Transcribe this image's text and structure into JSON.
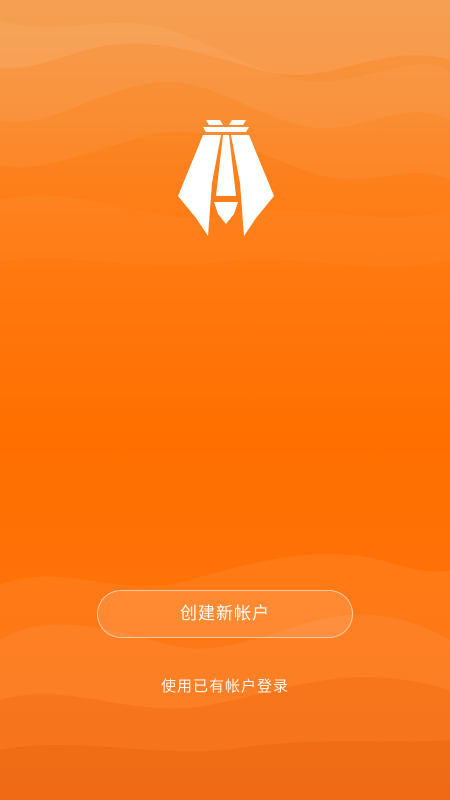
{
  "app": {
    "logo_icon": "cicada-a-logo-icon"
  },
  "actions": {
    "create_account_label": "创建新帐户",
    "login_existing_label": "使用已有帐户登录"
  },
  "colors": {
    "background_top": "#f5923a",
    "background_main": "#ff6f00",
    "logo": "#ffffff"
  }
}
